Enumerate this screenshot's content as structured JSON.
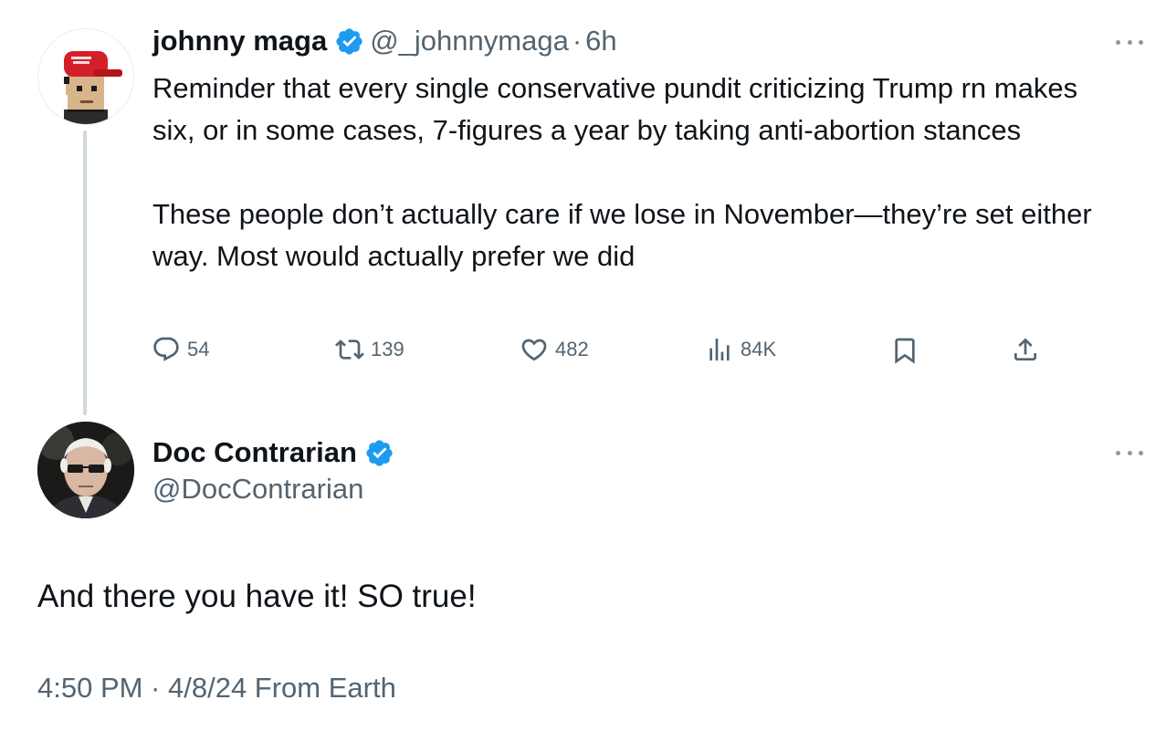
{
  "parent_tweet": {
    "author_name": "johnny maga",
    "author_handle": "@_johnnymaga",
    "separator": "·",
    "time": "6h",
    "verified": true,
    "avatar_icon": "pixel-avatar-red-cap-icon",
    "text": "Reminder that every single conservative pundit criticizing Trump rn makes six, or in some cases, 7-figures a year by taking anti-abortion stances\n\nThese people don’t actually care if we lose in November—they’re set either way. Most would actually prefer we did",
    "actions": {
      "replies": "54",
      "retweets": "139",
      "likes": "482",
      "views": "84K"
    }
  },
  "reply_tweet": {
    "author_name": "Doc Contrarian",
    "author_handle": "@DocContrarian",
    "verified": true,
    "avatar_icon": "photo-avatar-icon",
    "text": "And there you have it! SO true!",
    "meta": "4:50 PM · 4/8/24 From Earth"
  },
  "colors": {
    "text_primary": "#0f1419",
    "text_secondary": "#536471",
    "verified_badge": "#1d9bf0",
    "thread_line": "#cfd9de"
  }
}
